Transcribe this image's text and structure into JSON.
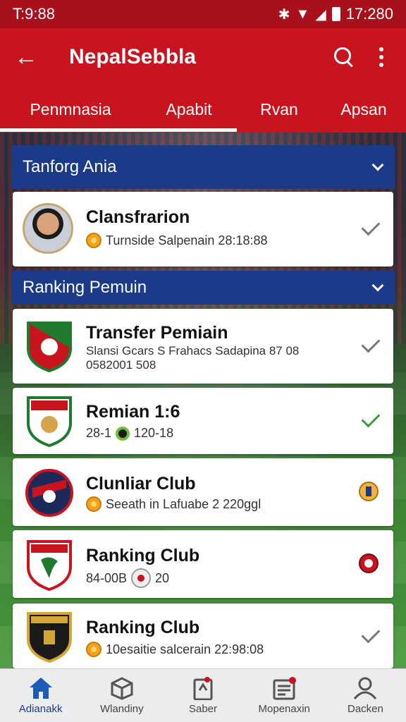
{
  "status_bar": {
    "time": "T:9:88",
    "clock": "17:280"
  },
  "app_bar": {
    "title": "NepalSebbla"
  },
  "tabs": [
    {
      "label": "Penmnasia",
      "active": true
    },
    {
      "label": "Apabit",
      "active": true
    },
    {
      "label": "Rvan",
      "active": false
    },
    {
      "label": "Apsan",
      "active": false
    }
  ],
  "sections": [
    {
      "title": "Tanforg Ania"
    },
    {
      "title": "Ranking Pemuin"
    }
  ],
  "cards": [
    {
      "title": "Clansfrarion",
      "subtitle": "Turnside Salpenain 28:18:88",
      "icon": "coin-icon",
      "status": "check"
    },
    {
      "title": "Transfer Pemiain",
      "subtitle": "Slansi Gcars S Frahacs Sadapina 87 08",
      "subtitle2": "0582001 508",
      "status": "check"
    },
    {
      "title": "Remian 1:6",
      "subtitle": "28-1",
      "subtitle_b": "120-18",
      "icon": "dot-badge",
      "status": "check-green"
    },
    {
      "title": "Clunliar Club",
      "subtitle": "Seeath in Lafuabe 2 220ggl",
      "icon": "coin-icon",
      "status": "badge"
    },
    {
      "title": "Ranking Club",
      "subtitle": "84-00B",
      "subtitle_b": "20",
      "icon": "ball-icon",
      "status": "badge-red"
    },
    {
      "title": "Ranking Club",
      "subtitle": "10esaitie salcerain 22:98:08",
      "icon": "coin-icon",
      "status": "check"
    }
  ],
  "bottom_nav": [
    {
      "label": "Adianakk",
      "icon": "home-icon",
      "active": true
    },
    {
      "label": "Wlandiny",
      "icon": "box-icon",
      "active": false
    },
    {
      "label": "Saber",
      "icon": "clipboard-icon",
      "active": false
    },
    {
      "label": "Mopenaxin",
      "icon": "inbox-icon",
      "active": false
    },
    {
      "label": "Dacken",
      "icon": "profile-icon",
      "active": false
    }
  ],
  "colors": {
    "primary": "#c8141f",
    "section": "#1c3a8a",
    "accent_green": "#3a9a3a"
  }
}
